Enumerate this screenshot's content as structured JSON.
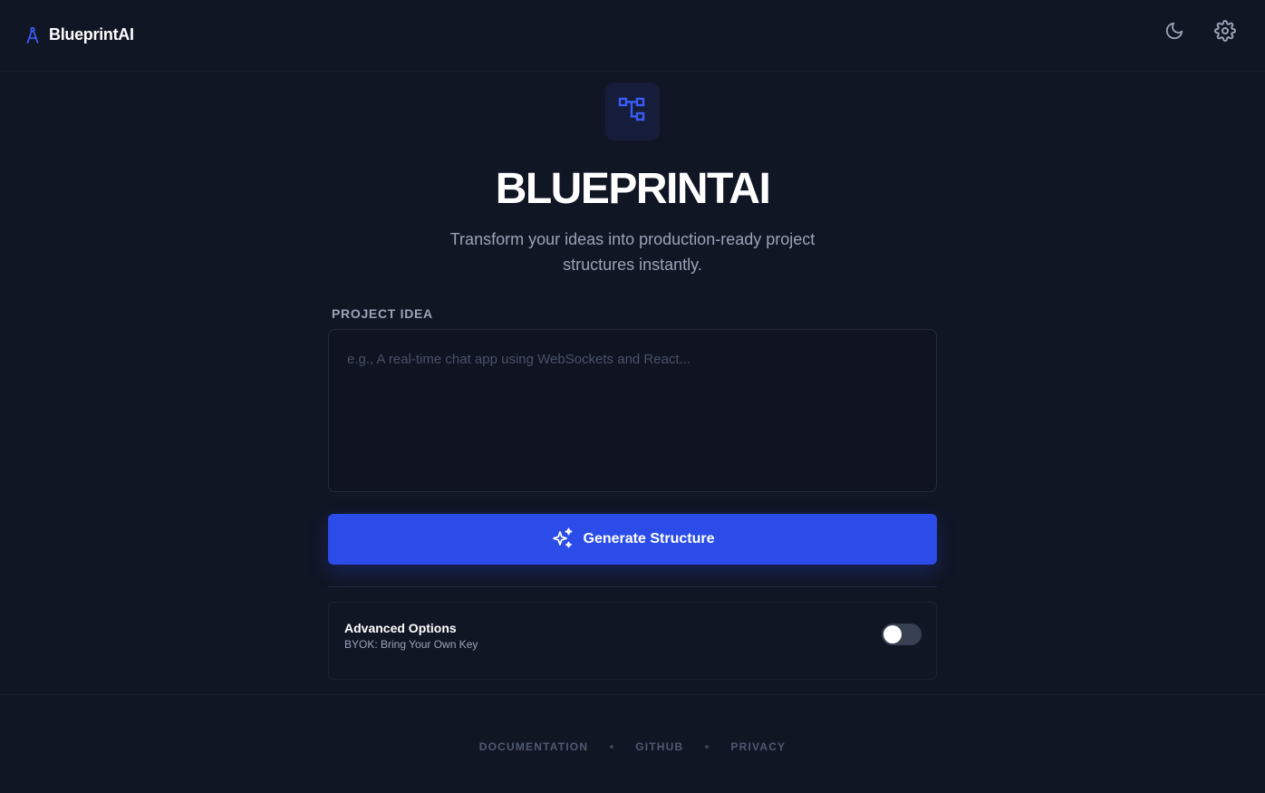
{
  "header": {
    "brand_name": "BlueprintAI",
    "brand_icon": "compass-icon",
    "theme_toggle_icon": "moon-icon",
    "settings_icon": "gear-icon"
  },
  "hero": {
    "badge_icon": "hierarchy-icon",
    "title": "BLUEPRINTAI",
    "subtitle": "Transform your ideas into production-ready project structures instantly."
  },
  "form": {
    "label": "PROJECT IDEA",
    "input_value": "",
    "input_placeholder": "e.g., A real-time chat app using WebSockets and React...",
    "generate_label": "Generate Structure",
    "generate_icon": "sparkles-icon"
  },
  "advanced": {
    "title": "Advanced Options",
    "subtitle": "BYOK: Bring Your Own Key",
    "toggle_on": false
  },
  "footer": {
    "links": [
      "DOCUMENTATION",
      "GITHUB",
      "PRIVACY"
    ]
  },
  "colors": {
    "background": "#111625",
    "accent": "#2b4ce8",
    "muted_text": "#9aa3b5"
  }
}
